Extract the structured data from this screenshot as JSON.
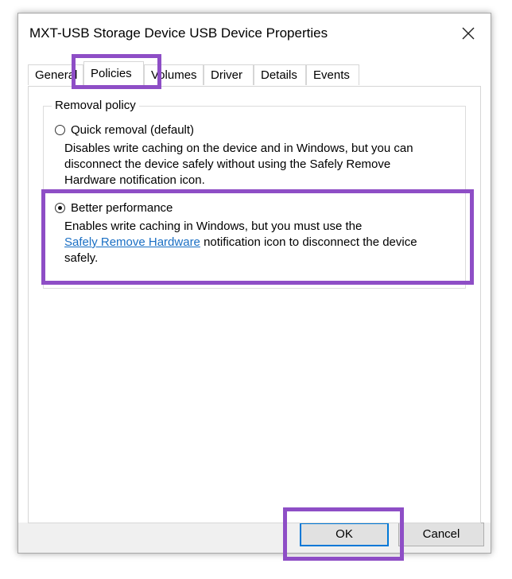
{
  "window": {
    "title": "MXT-USB Storage Device USB Device Properties",
    "close_icon": "close-icon"
  },
  "tabs": [
    {
      "label": "General",
      "active": false
    },
    {
      "label": "Policies",
      "active": true
    },
    {
      "label": "Volumes",
      "active": false
    },
    {
      "label": "Driver",
      "active": false
    },
    {
      "label": "Details",
      "active": false
    },
    {
      "label": "Events",
      "active": false
    }
  ],
  "removal_policy": {
    "legend": "Removal policy",
    "options": [
      {
        "label": "Quick removal (default)",
        "selected": false,
        "description_lines": [
          "Disables write caching on the device and in Windows, but you can",
          "disconnect the device safely without using the Safely Remove",
          "Hardware notification icon."
        ]
      },
      {
        "label": "Better performance",
        "selected": true,
        "description_line1": "Enables write caching in Windows, but you must use the",
        "link_text": "Safely Remove Hardware",
        "description_line2_rest": " notification icon to disconnect the device",
        "description_line3": "safely."
      }
    ]
  },
  "buttons": {
    "ok": "OK",
    "cancel": "Cancel"
  },
  "colors": {
    "highlight": "#8e4ec6",
    "link": "#1a6fc4",
    "default_button_border": "#0078d7"
  }
}
